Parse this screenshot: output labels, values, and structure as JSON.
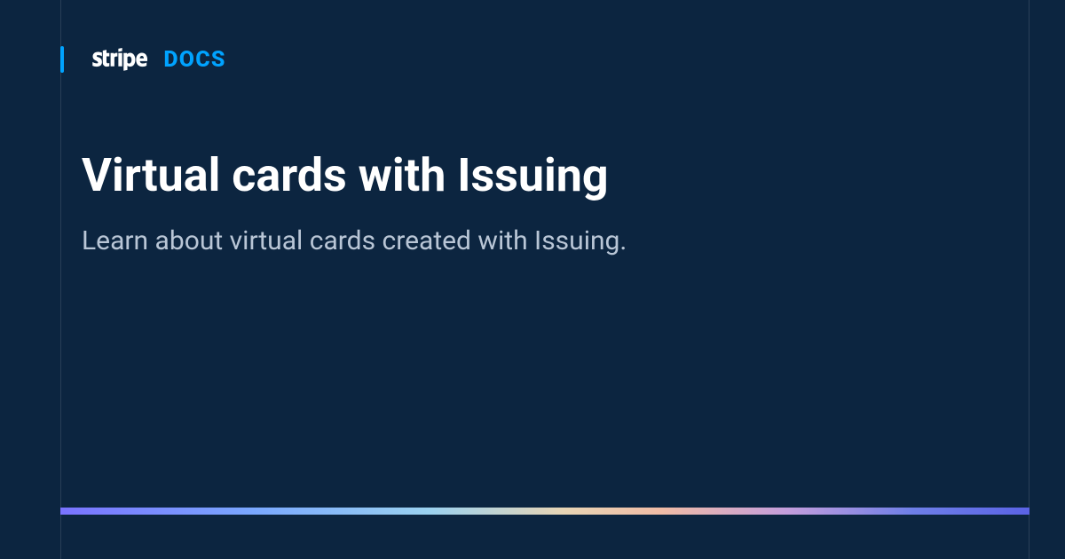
{
  "header": {
    "brand": "stripe",
    "docs_label": "DOCS"
  },
  "page": {
    "title": "Virtual cards with Issuing",
    "subtitle": "Learn about virtual cards created with Issuing."
  }
}
